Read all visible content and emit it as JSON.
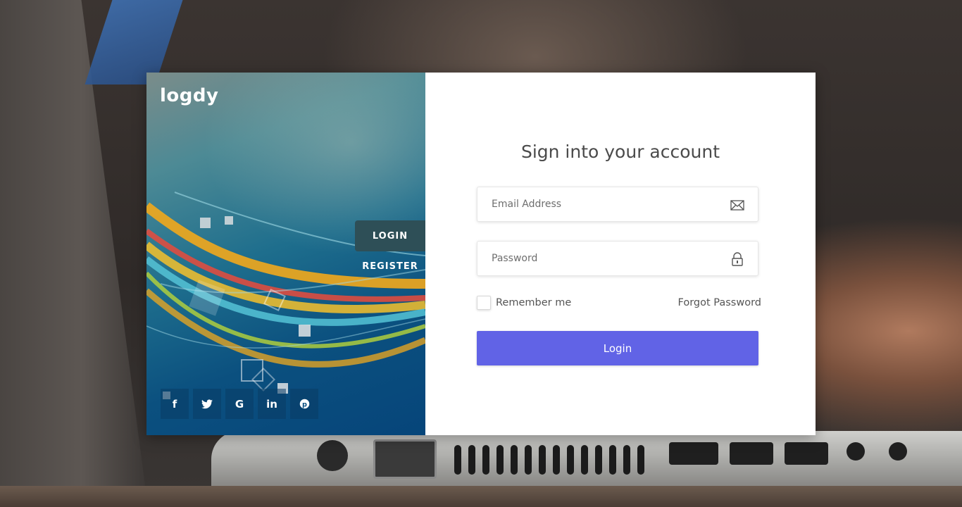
{
  "brand": {
    "name": "logdy"
  },
  "nav": {
    "login_tab": "LOGIN",
    "register_tab": "REGISTER"
  },
  "social": [
    {
      "icon": "facebook-icon",
      "glyph": "f"
    },
    {
      "icon": "twitter-icon",
      "glyph": "t"
    },
    {
      "icon": "google-icon",
      "glyph": "G"
    },
    {
      "icon": "linkedin-icon",
      "glyph": "in"
    },
    {
      "icon": "pinterest-icon",
      "glyph": "p"
    }
  ],
  "form": {
    "title": "Sign into your account",
    "email": {
      "placeholder": "Email Address",
      "value": "",
      "icon": "envelope-icon"
    },
    "password": {
      "placeholder": "Password",
      "value": "",
      "icon": "lock-icon"
    },
    "remember_label": "Remember me",
    "remember_checked": false,
    "forgot_label": "Forgot Password",
    "submit_label": "Login"
  },
  "colors": {
    "accent": "#6163e6",
    "tab_active": "#2e4f57",
    "panel_dark": "#06457a"
  }
}
